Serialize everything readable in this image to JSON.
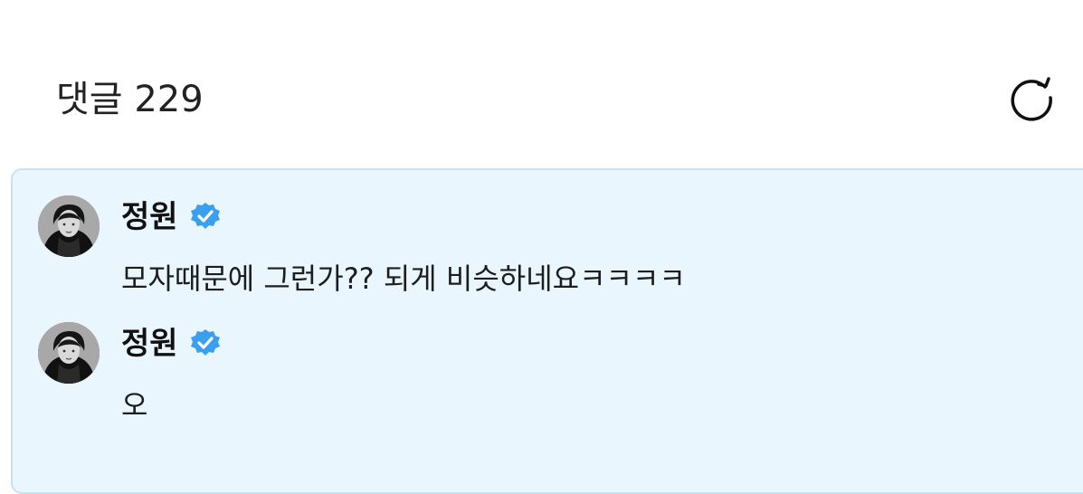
{
  "header": {
    "title": "댓글 229",
    "refresh_icon": "refresh-icon"
  },
  "comments": [
    {
      "author": "정원",
      "verified": true,
      "text": "모자때문에 그런가?? 되게 비슷하네요ㅋㅋㅋㅋ",
      "avatar_icon": "avatar"
    },
    {
      "author": "정원",
      "verified": true,
      "text": "오",
      "avatar_icon": "avatar"
    }
  ],
  "colors": {
    "panel_background": "#e9f6fd",
    "panel_border": "#c7e3ef",
    "verified_blue": "#3b9ff0",
    "text": "#1a1a1a"
  }
}
